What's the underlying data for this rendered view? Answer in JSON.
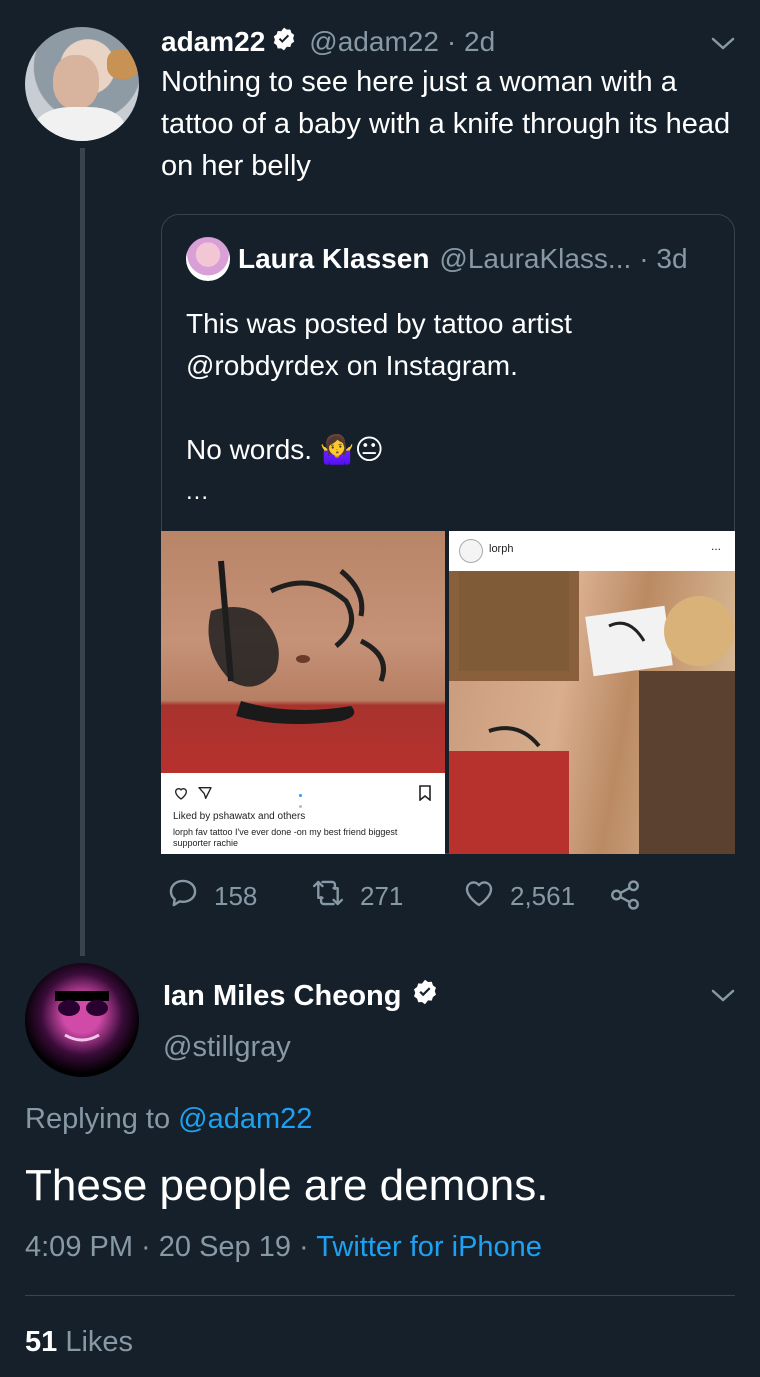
{
  "tweet1": {
    "display_name": "adam22",
    "handle": "@adam22",
    "time": "· 2d",
    "text": "Nothing to see here just a woman with a tattoo of a baby with a knife through its head on her belly",
    "quote": {
      "display_name": "Laura Klassen",
      "handle": "@LauraKlass...",
      "time": "· 3d",
      "text1": "This was posted by tattoo artist @robdyrdex on Instagram.",
      "text2": "No words. 🤷‍♀️😐",
      "ellipsis": "...",
      "ig_left": {
        "liked_by": "Liked by pshawatx and others",
        "caption": "lorph fav tattoo I've ever done -on my best friend biggest supporter rachie"
      },
      "ig_right": {
        "username": "lorph",
        "menu": "..."
      }
    },
    "replies": "158",
    "retweets": "271",
    "likes": "2,561"
  },
  "tweet2": {
    "display_name": "Ian Miles Cheong",
    "handle": "@stillgray",
    "replying_label": "Replying to",
    "replying_handle": "@adam22",
    "text": "These people are demons.",
    "time": "4:09 PM · 20 Sep 19 ·",
    "source": "Twitter for iPhone",
    "likes_count": "51",
    "likes_label": "Likes"
  },
  "colors": {
    "background": "#15202b",
    "muted": "#8899a6",
    "link": "#1da1f2",
    "border": "#38444d"
  }
}
